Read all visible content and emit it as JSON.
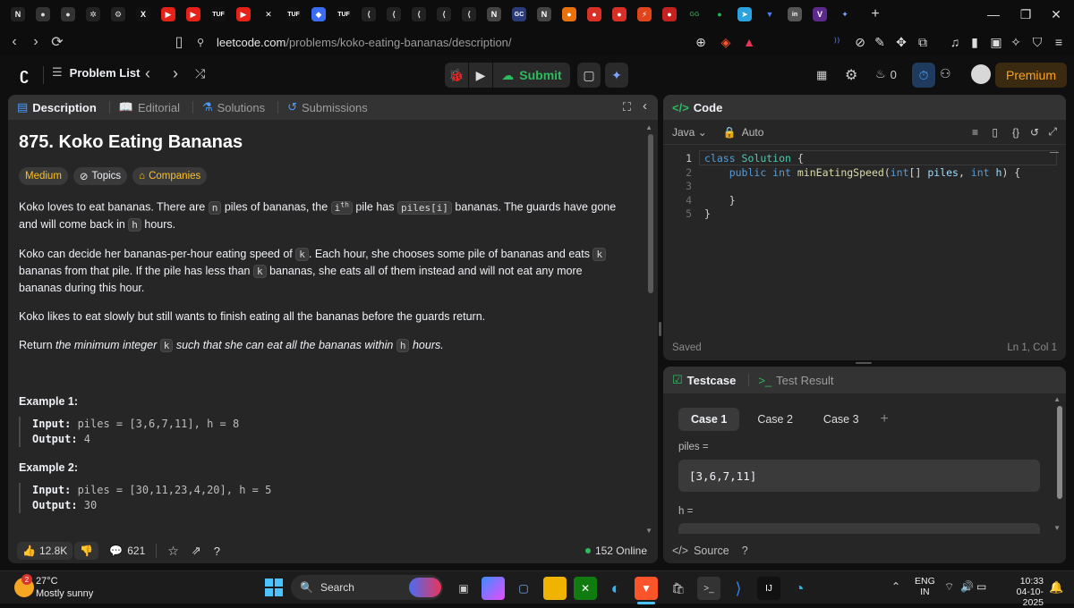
{
  "browser": {
    "tabs": [
      {
        "icon": "leetcode-tab-icon",
        "glyph": "N",
        "color": "#f4f4f4",
        "bg": "#222"
      },
      {
        "icon": "github-tab-icon",
        "glyph": "●",
        "color": "#ddd",
        "bg": "#333"
      },
      {
        "icon": "github-tab-icon",
        "glyph": "●",
        "color": "#ddd",
        "bg": "#333"
      },
      {
        "icon": "openai-tab-icon",
        "glyph": "✲",
        "color": "#ddd",
        "bg": "#222"
      },
      {
        "icon": "grid-tab-icon",
        "glyph": "⚙",
        "color": "#ddd",
        "bg": "#222"
      },
      {
        "icon": "x-tab-icon",
        "glyph": "X",
        "color": "#fff",
        "bg": "#111"
      },
      {
        "icon": "youtube-tab-icon",
        "glyph": "▶",
        "color": "#fff",
        "bg": "#e62117"
      },
      {
        "icon": "youtube-tab-icon",
        "glyph": "▶",
        "color": "#fff",
        "bg": "#e62117"
      },
      {
        "icon": "tuf-tab-icon",
        "glyph": "TUF",
        "color": "#fff",
        "bg": "#111"
      },
      {
        "icon": "youtube-tab-icon",
        "glyph": "▶",
        "color": "#fff",
        "bg": "#e62117"
      },
      {
        "icon": "close-icon",
        "glyph": "✕",
        "color": "#fff",
        "bg": "transparent"
      },
      {
        "icon": "tuf-tab-icon",
        "glyph": "TUF",
        "color": "#fff",
        "bg": "#111"
      },
      {
        "icon": "blue-tab-icon",
        "glyph": "◆",
        "color": "#fff",
        "bg": "#3b6cf5"
      },
      {
        "icon": "tuf-tab-icon",
        "glyph": "TUF",
        "color": "#fff",
        "bg": "#111"
      },
      {
        "icon": "leetcode-tab-icon",
        "glyph": "⟨",
        "color": "#ddd",
        "bg": "#222"
      },
      {
        "icon": "leetcode-tab-icon",
        "glyph": "⟨",
        "color": "#ddd",
        "bg": "#222"
      },
      {
        "icon": "leetcode-tab-icon",
        "glyph": "⟨",
        "color": "#ddd",
        "bg": "#222"
      },
      {
        "icon": "leetcode-tab-icon",
        "glyph": "⟨",
        "color": "#ddd",
        "bg": "#222"
      },
      {
        "icon": "leetcode-tab-icon",
        "glyph": "⟨",
        "color": "#ddd",
        "bg": "#222"
      },
      {
        "icon": "notion-tab-icon",
        "glyph": "N",
        "color": "#fff",
        "bg": "#444"
      },
      {
        "icon": "gfg-tab-icon",
        "glyph": "GC",
        "color": "#fff",
        "bg": "#2b3b7a"
      },
      {
        "icon": "notion-tab-icon",
        "glyph": "N",
        "color": "#fff",
        "bg": "#444"
      },
      {
        "icon": "orange-tab-icon",
        "glyph": "●",
        "color": "#fff",
        "bg": "#e8710a"
      },
      {
        "icon": "red-tab-icon",
        "glyph": "●",
        "color": "#fff",
        "bg": "#d93025"
      },
      {
        "icon": "red-tab-icon",
        "glyph": "●",
        "color": "#fff",
        "bg": "#d93025"
      },
      {
        "icon": "red-tab-icon",
        "glyph": "⚡",
        "color": "#fff",
        "bg": "#e0441a"
      },
      {
        "icon": "red-tab-icon",
        "glyph": "●",
        "color": "#fff",
        "bg": "#c5221f"
      },
      {
        "icon": "gfg-tab-icon",
        "glyph": "GG",
        "color": "#2f8d46",
        "bg": "transparent"
      },
      {
        "icon": "spotify-tab-icon",
        "glyph": "●",
        "color": "#1db954",
        "bg": "transparent"
      },
      {
        "icon": "telegram-tab-icon",
        "glyph": "➤",
        "color": "#fff",
        "bg": "#2aa3df"
      },
      {
        "icon": "blue-tab-icon",
        "glyph": "▼",
        "color": "#4a7cf5",
        "bg": "transparent"
      },
      {
        "icon": "linkedin-tab-icon",
        "glyph": "in",
        "color": "#fff",
        "bg": "#555"
      },
      {
        "icon": "vercel-tab-icon",
        "glyph": "V",
        "color": "#fff",
        "bg": "#5b2a8c"
      },
      {
        "icon": "gemini-tab-icon",
        "glyph": "✦",
        "color": "#7aa6ff",
        "bg": "transparent"
      }
    ],
    "new_tab": "+",
    "url_host": "leetcode.com",
    "url_path": "/problems/koko-eating-bananas/description/"
  },
  "header": {
    "problem_list": "Problem List",
    "submit": "Submit",
    "streak": "0",
    "premium": "Premium"
  },
  "description": {
    "tabs": [
      "Description",
      "Editorial",
      "Solutions",
      "Submissions"
    ],
    "title": "875. Koko Eating Bananas",
    "difficulty": "Medium",
    "topics": "Topics",
    "companies": "Companies",
    "p1_a": "Koko loves to eat bananas. There are ",
    "p1_n": "n",
    "p1_b": " piles of bananas, the ",
    "p1_i": "i",
    "p1_th": "th",
    "p1_c": " pile has ",
    "p1_piles": "piles[i]",
    "p1_d": " bananas. The guards have gone and will come back in ",
    "p1_h": "h",
    "p1_e": " hours.",
    "p2_a": "Koko can decide her bananas-per-hour eating speed of ",
    "p2_k": "k",
    "p2_b": ". Each hour, she chooses some pile of bananas and eats ",
    "p2_c": " bananas from that pile. If the pile has less than ",
    "p2_d": " bananas, she eats all of them instead and will not eat any more bananas during this hour.",
    "p3": "Koko likes to eat slowly but still wants to finish eating all the bananas before the guards return.",
    "p4_a": "Return ",
    "p4_b": "the minimum integer",
    "p4_c": "such that she can eat all the bananas within",
    "p4_d": "hours.",
    "examples": [
      {
        "heading": "Example 1:",
        "input_label": "Input:",
        "input": " piles = [3,6,7,11], h = 8",
        "output_label": "Output:",
        "output": " 4"
      },
      {
        "heading": "Example 2:",
        "input_label": "Input:",
        "input": " piles = [30,11,23,4,20], h = 5",
        "output_label": "Output:",
        "output": " 30"
      }
    ],
    "likes": "12.8K",
    "comments": "621",
    "online": "152 Online"
  },
  "code": {
    "title": "Code",
    "language": "Java",
    "auto": "Auto",
    "lines": [
      {
        "n": "1",
        "parts": [
          [
            "kw",
            "class "
          ],
          [
            "ty",
            "Solution"
          ],
          [
            "pl",
            " {"
          ]
        ]
      },
      {
        "n": "2",
        "parts": [
          [
            "pl",
            "    "
          ],
          [
            "kw",
            "public int "
          ],
          [
            "fn",
            "minEatingSpeed"
          ],
          [
            "pl",
            "("
          ],
          [
            "kw",
            "int"
          ],
          [
            "pl",
            "[] "
          ],
          [
            "vr",
            "piles"
          ],
          [
            "pl",
            ", "
          ],
          [
            "kw",
            "int "
          ],
          [
            "vr",
            "h"
          ],
          [
            "pl",
            ") {"
          ]
        ]
      },
      {
        "n": "3",
        "parts": [
          [
            "pl",
            ""
          ]
        ]
      },
      {
        "n": "4",
        "parts": [
          [
            "pl",
            "    }"
          ]
        ]
      },
      {
        "n": "5",
        "parts": [
          [
            "pl",
            "}"
          ]
        ]
      }
    ],
    "saved": "Saved",
    "cursor": "Ln 1, Col 1"
  },
  "testcase": {
    "tabs": [
      "Testcase",
      "Test Result"
    ],
    "cases": [
      "Case 1",
      "Case 2",
      "Case 3"
    ],
    "add": "+",
    "var1_label": "piles =",
    "var1_value": "[3,6,7,11]",
    "var2_label": "h =",
    "source": "Source"
  },
  "taskbar": {
    "weather_temp": "27°C",
    "weather_desc": "Mostly sunny",
    "weather_badge": "2",
    "search": "Search",
    "lang": "ENG",
    "region": "IN",
    "time": "10:33",
    "date": "04-10-2025"
  }
}
